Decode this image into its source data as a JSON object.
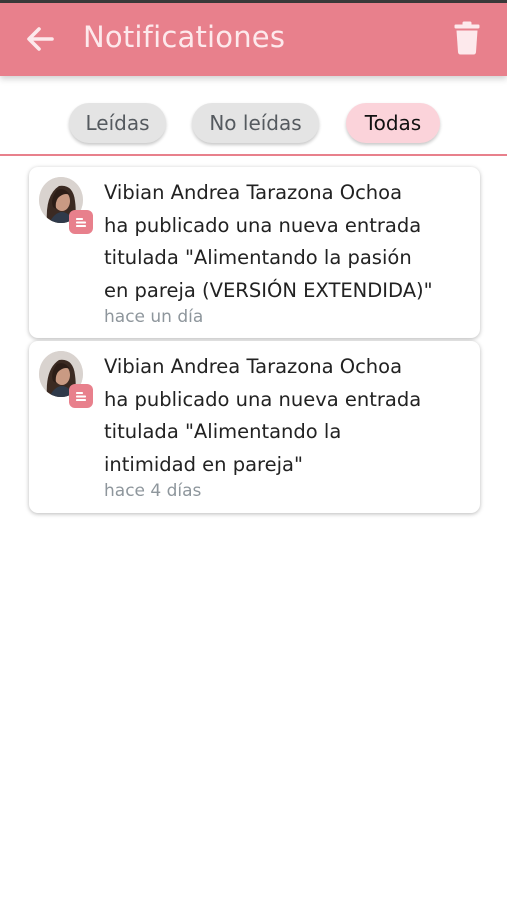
{
  "header": {
    "title": "Notificationes",
    "back_icon": "arrow-left-icon",
    "delete_icon": "trash-icon",
    "bar_color": "#e8808c"
  },
  "tabs": [
    {
      "label": "Leídas",
      "active": false
    },
    {
      "label": "No leídas",
      "active": false
    },
    {
      "label": "Todas",
      "active": true
    }
  ],
  "notifications": [
    {
      "lines": [
        "Vibian Andrea Tarazona Ochoa",
        "ha publicado una nueva entrada",
        "titulada \"Alimentando la pasión",
        "en pareja (VERSIÓN EXTENDIDA)\""
      ],
      "time": "hace un día",
      "badge_icon": "document-icon"
    },
    {
      "lines": [
        "Vibian Andrea Tarazona Ochoa",
        "ha publicado una nueva entrada",
        "titulada \"Alimentando la",
        "intimidad en pareja\""
      ],
      "time": "hace 4 días",
      "badge_icon": "document-icon"
    }
  ]
}
